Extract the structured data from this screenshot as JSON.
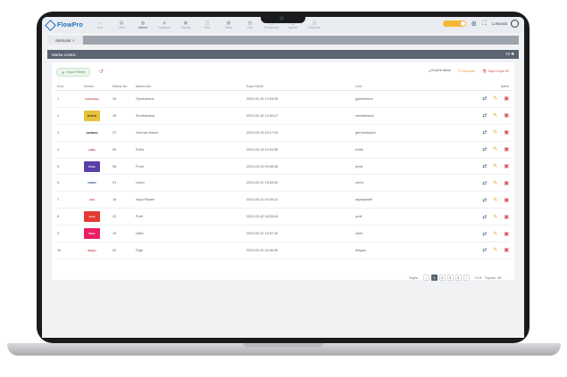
{
  "app": {
    "name": "FlowPro"
  },
  "nav": [
    {
      "icon": "⌂",
      "label": "Ana"
    },
    {
      "icon": "▤",
      "label": "Ürün"
    },
    {
      "icon": "◎",
      "label": "Marka"
    },
    {
      "icon": "◈",
      "label": "Kategori"
    },
    {
      "icon": "▣",
      "label": "Sipariş"
    },
    {
      "icon": "◫",
      "label": "Stok"
    },
    {
      "icon": "▦",
      "label": "Satış"
    },
    {
      "icon": "▧",
      "label": "Cari"
    },
    {
      "icon": "◰",
      "label": "Kampanya"
    },
    {
      "icon": "◱",
      "label": "Ayarlar"
    },
    {
      "icon": "◲",
      "label": "Raporlar"
    }
  ],
  "user": {
    "name": "Lokanda"
  },
  "tab": {
    "label": "Markalar ×"
  },
  "section": {
    "title": "Marka Listesi",
    "count": "72 ✚"
  },
  "toolbar": {
    "filter_label": "Kayıt Filtrele",
    "export_label": "Excel'e Aktar",
    "edit_label": "Güncelle",
    "delete_label": "Toplu Kayıt Sil"
  },
  "table": {
    "headers": [
      "Sıra",
      "Resim",
      "Marka No",
      "Marka Adı",
      "Kayıt Tarihi",
      "Link",
      "İşlem"
    ],
    "rows": [
      {
        "n": "1",
        "logo_text": "Gymbobax",
        "logo_color": "#ffffff",
        "logo_fg": "#c0392b",
        "id": "26",
        "name": "Gymbobaux",
        "date": "2024-01-16 10:54:28",
        "link": "gymbobaux"
      },
      {
        "n": "2",
        "logo_text": "DARTS",
        "logo_color": "#e5c23a",
        "logo_fg": "#3b2b00",
        "id": "28",
        "name": "Sembalvana",
        "date": "2023-03-18 14:49:27",
        "link": "sembalvana"
      },
      {
        "n": "3",
        "logo_text": "GERMAN",
        "logo_color": "#ffffff",
        "logo_fg": "#222222",
        "id": "37",
        "name": "German Kasch",
        "date": "2023-03-13 15:17:43",
        "link": "germankasch"
      },
      {
        "n": "4",
        "logo_text": "evlila",
        "logo_color": "#ffffff",
        "logo_fg": "#c2185b",
        "id": "59",
        "name": "Evlila",
        "date": "2023-03-13 10:04:38",
        "link": "evlila"
      },
      {
        "n": "5",
        "logo_text": "Pinar",
        "logo_color": "#5b3fa8",
        "logo_fg": "#ffffff",
        "id": "58",
        "name": "Pınar",
        "date": "2023-03-13 09:48:48",
        "link": "pinar"
      },
      {
        "n": "6",
        "logo_text": "UNIVO",
        "logo_color": "#ffffff",
        "logo_fg": "#1c3d78",
        "id": "51",
        "name": "Univo",
        "date": "2023-03-12 15:53:34",
        "link": "univo"
      },
      {
        "n": "7",
        "logo_text": "ASA",
        "logo_color": "#ffffff",
        "logo_fg": "#d32f2f",
        "id": "16",
        "name": "Asya Pazarlı",
        "date": "2023-03-12 09:45:12",
        "link": "asyapazarli"
      },
      {
        "n": "8",
        "logo_text": "profi",
        "logo_color": "#e53935",
        "logo_fg": "#ffffff",
        "id": "22",
        "name": "Profi",
        "date": "2023-03-10 16:53:44",
        "link": "profi"
      },
      {
        "n": "9",
        "logo_text": "Ülker",
        "logo_color": "#e91e63",
        "logo_fg": "#ffffff",
        "id": "15",
        "name": "Ülker",
        "date": "2023-03-10 15:57:45",
        "link": "ulker"
      },
      {
        "n": "10",
        "logo_text": "dragos",
        "logo_color": "#ffffff",
        "logo_fg": "#c62828",
        "id": "52",
        "name": "Drgs",
        "date": "2023-03-10 10:46:36",
        "link": "dragos"
      }
    ]
  },
  "pager": {
    "label": "Sayfa",
    "pages": [
      "‹",
      "1",
      "2",
      "3",
      "4",
      "›"
    ],
    "active": "1",
    "size_label": "10 ▾",
    "total_label": "Toplam: 68"
  }
}
